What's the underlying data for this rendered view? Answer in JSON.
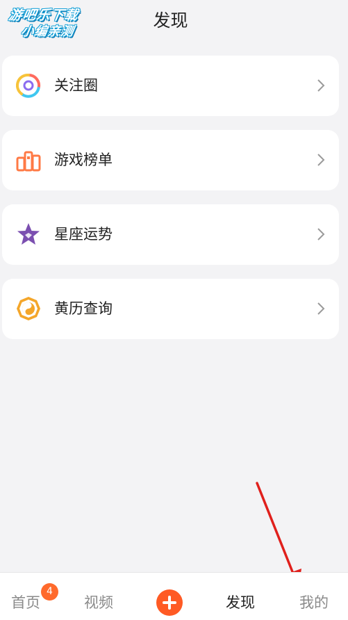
{
  "header": {
    "title": "发现",
    "watermark_line1": "游吧乐下载",
    "watermark_line2": "小编亲测"
  },
  "menu": {
    "items": [
      {
        "label": "关注圈",
        "icon": "follow-circle-icon"
      },
      {
        "label": "游戏榜单",
        "icon": "game-ranking-icon"
      },
      {
        "label": "星座运势",
        "icon": "horoscope-star-icon"
      },
      {
        "label": "黄历查询",
        "icon": "almanac-bagua-icon"
      }
    ]
  },
  "tabbar": {
    "home_label": "首页",
    "home_badge": "4",
    "video_label": "视频",
    "discover_label": "发现",
    "mine_label": "我的"
  },
  "colors": {
    "accent": "#ff5a24",
    "badge": "#ff6a2c",
    "background": "#f3f3f5",
    "annotation_arrow": "#e0201c"
  }
}
